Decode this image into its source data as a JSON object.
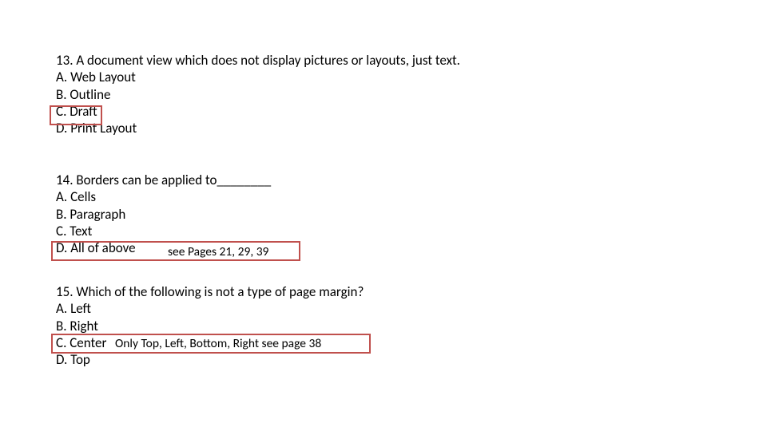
{
  "q13": {
    "question": "13. A document view which does not display pictures or layouts, just text.",
    "a": "A. Web Layout",
    "b": "B. Outline",
    "c": "C. Draft",
    "d": "D. Print Layout"
  },
  "q14": {
    "question": "14. Borders can be applied to________",
    "a": "A. Cells",
    "b": "B. Paragraph",
    "c": "C. Text",
    "d": "D. All of above",
    "note": "see Pages 21, 29, 39"
  },
  "q15": {
    "question": "15. Which of the following is not a type of page margin?",
    "a": "A. Left",
    "b": "B. Right",
    "c": "C. Center",
    "d": "D. Top",
    "note": "Only Top, Left, Bottom, Right see page 38"
  }
}
